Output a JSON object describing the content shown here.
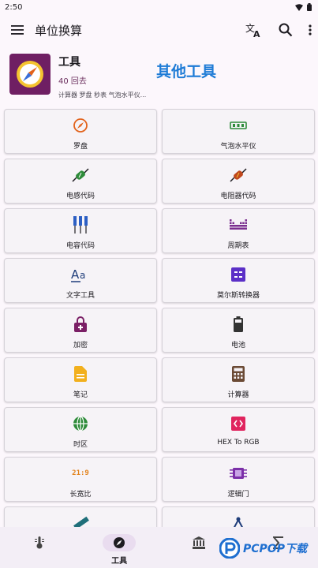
{
  "status": {
    "time": "2:50"
  },
  "appbar": {
    "title": "单位换算"
  },
  "header": {
    "name": "工具",
    "back": "40 回去",
    "description": "计算器 罗盘 秒表 气泡水平仪...",
    "overlay": "其他工具"
  },
  "tools": [
    {
      "label": "罗盘",
      "icon": "compass-icon",
      "color": "#e2621b"
    },
    {
      "label": "气泡水平仪",
      "icon": "bubble-level-icon",
      "color": "#2e8b3a"
    },
    {
      "label": "电感代码",
      "icon": "inductor-icon",
      "color": "#2e8b3a"
    },
    {
      "label": "电阻器代码",
      "icon": "resistor-icon",
      "color": "#c0471d"
    },
    {
      "label": "电容代码",
      "icon": "capacitor-icon",
      "color": "#2c5fc4"
    },
    {
      "label": "周期表",
      "icon": "periodic-table-icon",
      "color": "#7b2f8f"
    },
    {
      "label": "文字工具",
      "icon": "text-tool-icon",
      "color": "#1f3d7a"
    },
    {
      "label": "莫尔斯转换器",
      "icon": "morse-icon",
      "color": "#5b2fc7"
    },
    {
      "label": "加密",
      "icon": "lock-icon",
      "color": "#7b1f66"
    },
    {
      "label": "电池",
      "icon": "battery-icon",
      "color": "#333333"
    },
    {
      "label": "笔记",
      "icon": "note-icon",
      "color": "#f2b01e"
    },
    {
      "label": "计算器",
      "icon": "calculator-icon",
      "color": "#6b4a35"
    },
    {
      "label": "时区",
      "icon": "globe-icon",
      "color": "#2e8b3a"
    },
    {
      "label": "HEX To RGB",
      "icon": "hex-icon",
      "color": "#e0245e"
    },
    {
      "label": "长宽比",
      "icon": "aspect-ratio-icon",
      "color": "#e2821b",
      "text": "21:9"
    },
    {
      "label": "逻辑门",
      "icon": "chip-icon",
      "color": "#7b2fa8"
    },
    {
      "label": "",
      "icon": "ruler-icon",
      "color": "#1f6f7a"
    },
    {
      "label": "",
      "icon": "protractor-icon",
      "color": "#1f3d7a"
    }
  ],
  "bottomnav": {
    "items": [
      {
        "icon": "thermometer-icon",
        "label": ""
      },
      {
        "icon": "compass-nav-icon",
        "label": "工具"
      },
      {
        "icon": "bank-icon",
        "label": ""
      },
      {
        "icon": "sigma-icon",
        "label": ""
      }
    ]
  },
  "watermark": {
    "text": "PCPOP下载"
  }
}
